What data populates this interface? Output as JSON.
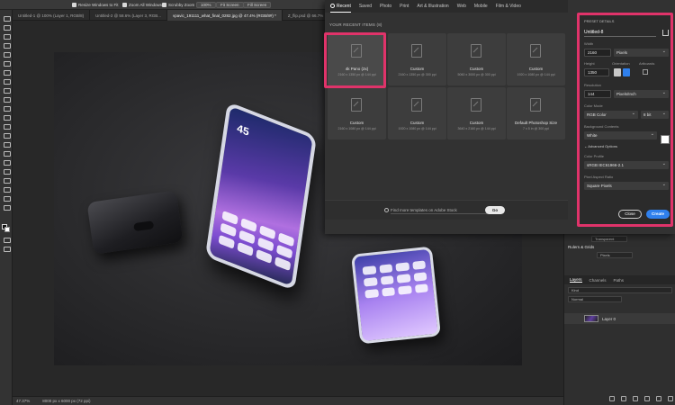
{
  "options_bar": {
    "resize_windows": "Resize Windows to Fit",
    "zoom_all": "Zoom All Windows",
    "scrubby_zoom": "Scrubby Zoom",
    "zoom_pct": "100%",
    "fit_screen": "Fit Screen",
    "fill_screen": "Fill Screen"
  },
  "doc_tabs": [
    {
      "label": "Untitled-1 @ 100% (Layer 1, RGB/8)"
    },
    {
      "label": "Untitled-2 @ 58.6% (Layer 3, RGB..."
    },
    {
      "label": "vpavic_191111_what_final_0282.jpg @ 47.4% (RGB/8#) *"
    },
    {
      "label": "Z_flip.psd @ 66.7%"
    }
  ],
  "status_bar": {
    "zoom": "47.37%",
    "doc_size": "8000 px x 6000 px (72 ppi)"
  },
  "dialog": {
    "tabs": [
      "Recent",
      "Saved",
      "Photo",
      "Print",
      "Art & Illustration",
      "Web",
      "Mobile",
      "Film & Video"
    ],
    "recent_title": "YOUR RECENT ITEMS",
    "recent_count": "(8)",
    "presets": [
      {
        "name": "4k Pano (2x)",
        "spec": "2160 x 1350 px @ 144 ppi"
      },
      {
        "name": "Custom",
        "spec": "2160 x 1350 px @ 300 ppi"
      },
      {
        "name": "Custom",
        "spec": "5060 x 3000 px @ 300 ppi"
      },
      {
        "name": "Custom",
        "spec": "1920 x 1080 px @ 144 ppi"
      },
      {
        "name": "Custom",
        "spec": "2160 x 1080 px @ 144 ppi"
      },
      {
        "name": "Custom",
        "spec": "1920 x 1080 px @ 144 ppi"
      },
      {
        "name": "Custom",
        "spec": "3640 x 2160 px @ 144 ppi"
      },
      {
        "name": "Default Photoshop Size",
        "spec": "7 x 5 in @ 300 ppi"
      }
    ],
    "search_placeholder": "Find more templates on Adobe Stock",
    "go_label": "Go"
  },
  "details": {
    "title": "PRESET DETAILS",
    "doc_name": "Untitled-8",
    "width_label": "Width",
    "width_value": "2160",
    "width_unit": "Pixels",
    "height_label": "Height",
    "height_value": "1350",
    "orientation_label": "Orientation",
    "artboards_label": "Artboards",
    "resolution_label": "Resolution",
    "resolution_value": "144",
    "resolution_unit": "Pixels/Inch",
    "color_mode_label": "Color Mode",
    "color_mode_value": "RGB Color",
    "bit_depth": "8 bit",
    "bg_label": "Background Contents",
    "bg_value": "White",
    "advanced_label": "Advanced Options",
    "color_profile_label": "Color Profile",
    "color_profile_value": "sRGB IEC61966-2.1",
    "pixel_aspect_label": "Pixel Aspect Ratio",
    "pixel_aspect_value": "Square Pixels",
    "close_label": "Close",
    "create_label": "Create"
  },
  "right_panel": {
    "transparent_label": "Transparent",
    "rulers_grids": "Rulers & Grids",
    "pixels_label": "Pixels",
    "tabs": [
      "Layers",
      "Channels",
      "Paths"
    ],
    "kind_label": "Kind",
    "normal_label": "Normal",
    "layer_name": "Layer 0"
  },
  "phone": {
    "clock": "45"
  },
  "colors": {
    "highlight": "#e0336a",
    "create_blue": "#2f80ed"
  }
}
